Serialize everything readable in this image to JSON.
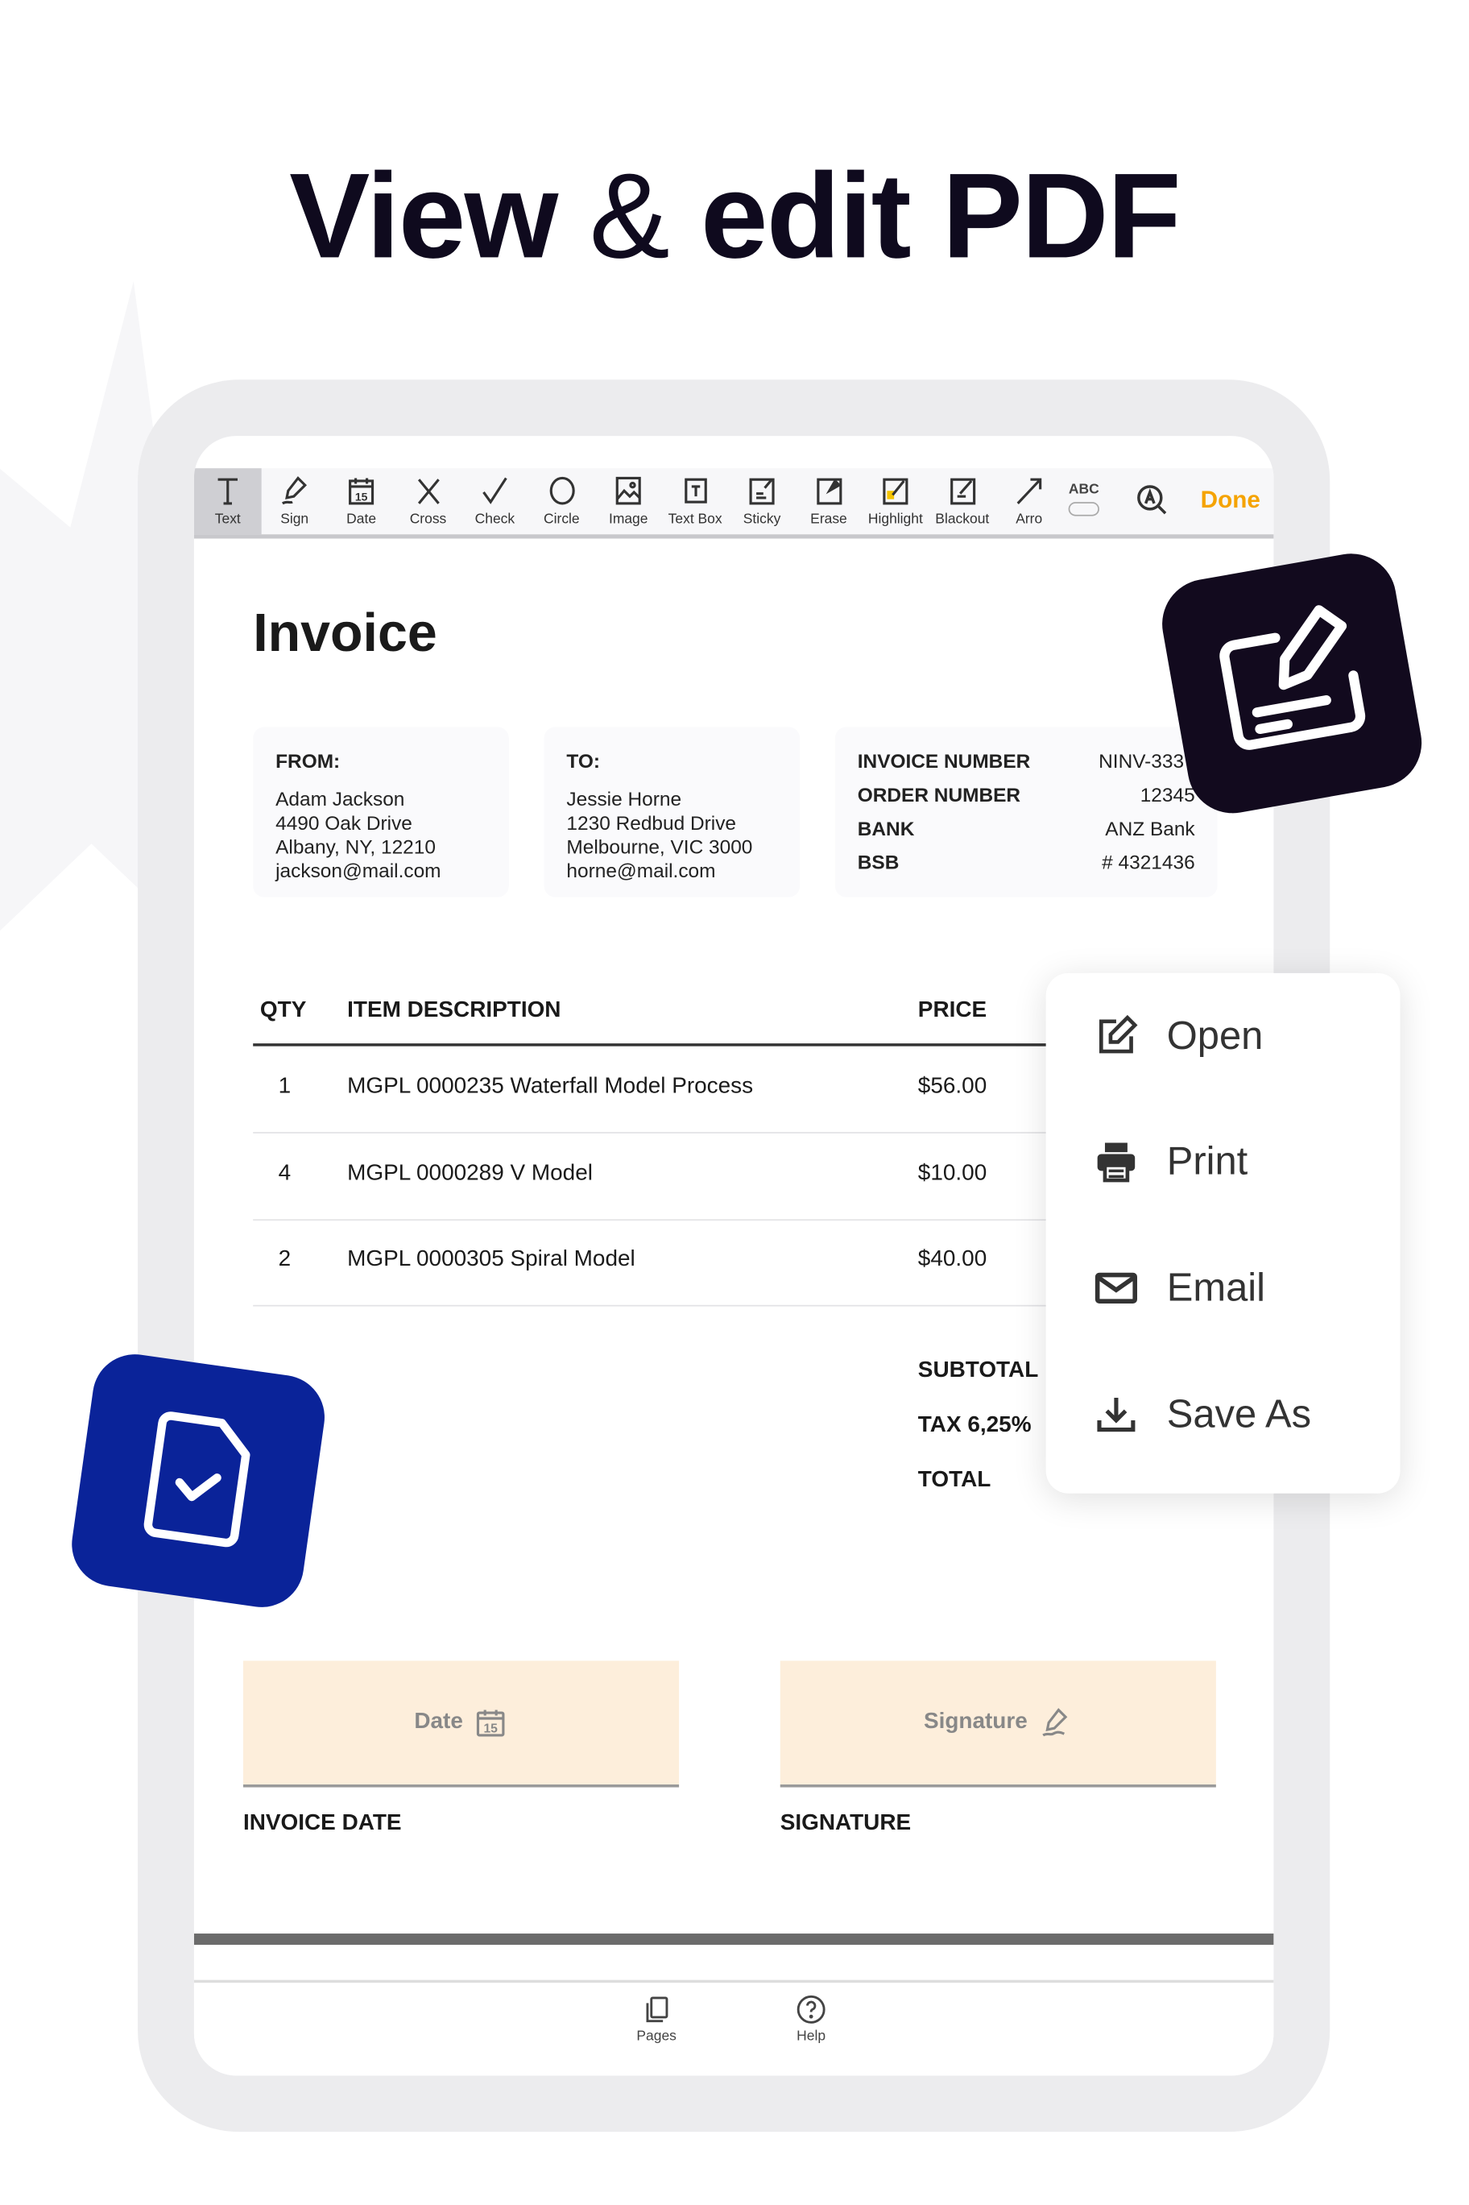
{
  "headline": {
    "part1": "View",
    "amp": "&",
    "part2": "edit PDF"
  },
  "toolbar": {
    "tools": [
      {
        "label": "Text",
        "icon": "text-icon"
      },
      {
        "label": "Sign",
        "icon": "sign-icon"
      },
      {
        "label": "Date",
        "icon": "calendar-icon"
      },
      {
        "label": "Cross",
        "icon": "cross-icon"
      },
      {
        "label": "Check",
        "icon": "check-icon"
      },
      {
        "label": "Circle",
        "icon": "circle-icon"
      },
      {
        "label": "Image",
        "icon": "image-icon"
      },
      {
        "label": "Text Box",
        "icon": "text-box-icon"
      },
      {
        "label": "Sticky",
        "icon": "sticky-icon"
      },
      {
        "label": "Erase",
        "icon": "erase-icon"
      },
      {
        "label": "Highlight",
        "icon": "highlight-icon"
      },
      {
        "label": "Blackout",
        "icon": "blackout-icon"
      },
      {
        "label": "Arro",
        "icon": "arrow-icon"
      }
    ],
    "abc": "ABC",
    "done": "Done",
    "accent": "#f5a300"
  },
  "invoice": {
    "title": "Invoice",
    "from": {
      "heading": "FROM:",
      "lines": [
        "Adam Jackson",
        "4490 Oak Drive",
        "Albany, NY, 12210",
        "jackson@mail.com"
      ]
    },
    "to": {
      "heading": "TO:",
      "lines": [
        "Jessie Horne",
        "1230 Redbud Drive",
        "Melbourne, VIC 3000",
        "horne@mail.com"
      ]
    },
    "info": [
      {
        "label": "INVOICE NUMBER",
        "value": "NINV-3337"
      },
      {
        "label": "ORDER NUMBER",
        "value": "12345"
      },
      {
        "label": "BANK",
        "value": "ANZ Bank"
      },
      {
        "label": "BSB",
        "value": "# 4321436"
      }
    ],
    "columns": [
      "QTY",
      "ITEM DESCRIPTION",
      "PRICE"
    ],
    "rows": [
      {
        "qty": "1",
        "desc": "MGPL 0000235 Waterfall Model Process",
        "price": "$56.00"
      },
      {
        "qty": "4",
        "desc": "MGPL 0000289 V Model",
        "price": "$10.00"
      },
      {
        "qty": "2",
        "desc": "MGPL 0000305 Spiral Model",
        "price": "$40.00"
      }
    ],
    "totals": [
      "SUBTOTAL",
      "TAX 6,25%",
      "TOTAL"
    ],
    "date_field": "Date",
    "signature_field": "Signature",
    "date_label": "INVOICE DATE",
    "signature_label": "SIGNATURE"
  },
  "bottombar": {
    "pages": "Pages",
    "help": "Help"
  },
  "menu": {
    "items": [
      "Open",
      "Print",
      "Email",
      "Save As"
    ]
  }
}
